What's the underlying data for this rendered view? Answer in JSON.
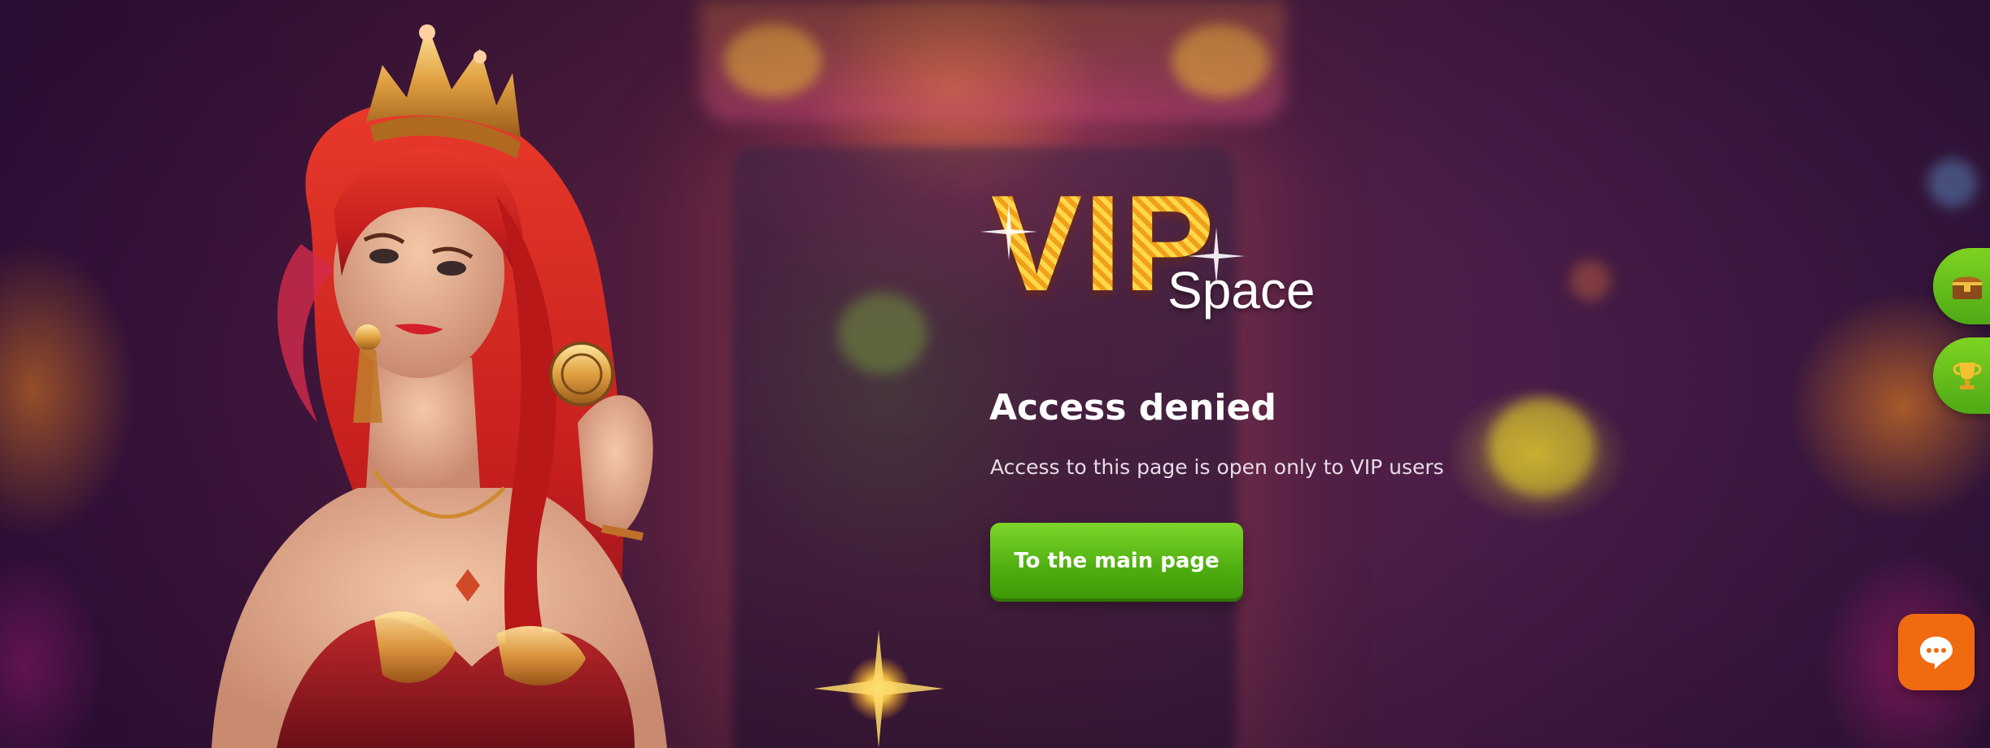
{
  "logo": {
    "brand_main": "VIP",
    "brand_sub": "Space"
  },
  "content": {
    "title": "Access denied",
    "subtitle": "Access to this page is open only to VIP users",
    "main_button_label": "To the main page"
  },
  "side_widgets": [
    {
      "icon": "treasure-chest-icon"
    },
    {
      "icon": "trophy-icon"
    }
  ],
  "chat": {
    "icon": "chat-bubble-icon"
  },
  "colors": {
    "accent_green": "#5cbf14",
    "gold": "#f6b21c",
    "chat_orange": "#f06a10",
    "background": "#4a1a3c"
  }
}
